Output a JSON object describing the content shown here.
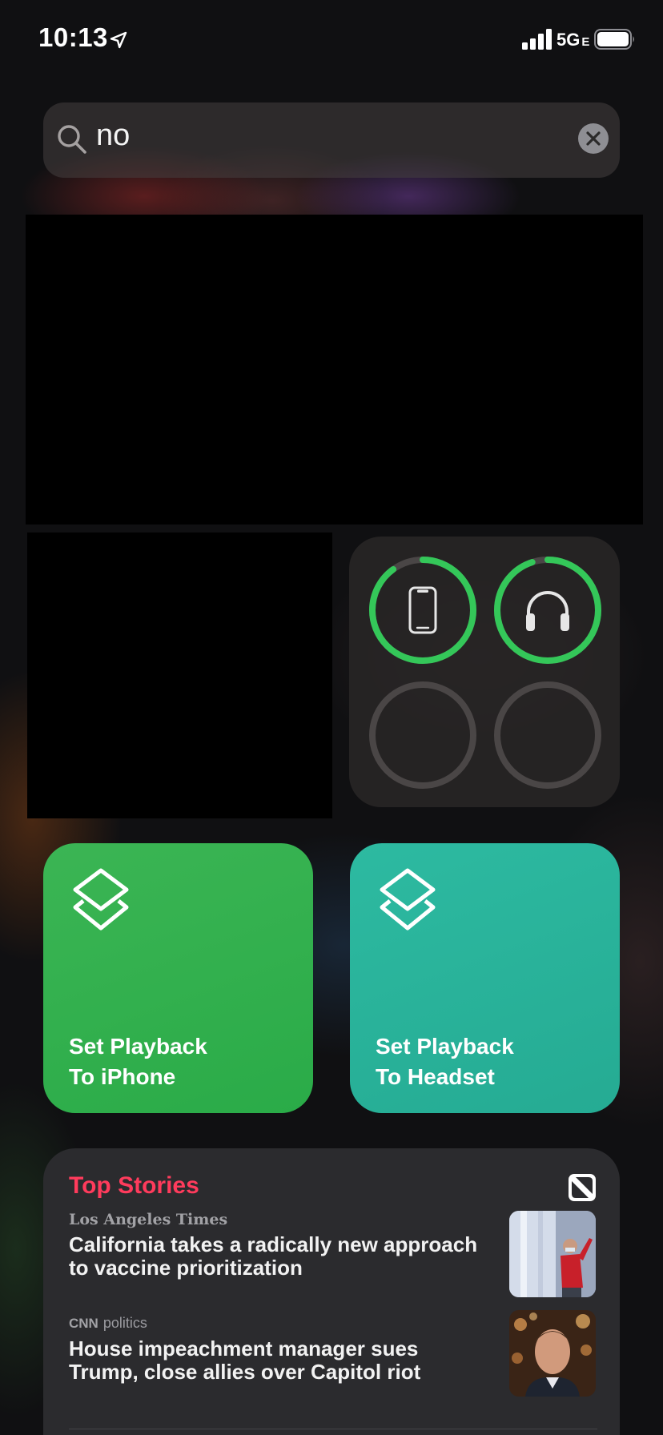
{
  "status_bar": {
    "time": "10:13",
    "network": "5G",
    "network_sub": "E",
    "location_icon": "location-arrow-icon",
    "signal_icon": "cellular-signal-icon",
    "battery_icon": "battery-icon"
  },
  "search": {
    "query": "no",
    "search_icon": "magnifying-glass-icon",
    "clear_icon": "clear-x-icon"
  },
  "batteries_widget": {
    "accent_color": "#34c759",
    "track_color": "#4a4646",
    "devices": [
      {
        "icon": "iphone-icon",
        "level": 0.9
      },
      {
        "icon": "headphones-icon",
        "level": 0.95
      },
      {
        "icon": "empty-slot",
        "level": 0
      },
      {
        "icon": "empty-slot",
        "level": 0
      }
    ]
  },
  "shortcuts": [
    {
      "label_line1": "Set Playback",
      "label_line2": "To iPhone",
      "icon": "shortcuts-layers-icon",
      "color": "#31b04f"
    },
    {
      "label_line1": "Set Playback",
      "label_line2": "To Headset",
      "icon": "shortcuts-layers-icon",
      "color": "#29b39a"
    }
  ],
  "news": {
    "title": "Top Stories",
    "title_color": "#ff3b5c",
    "logo_icon": "apple-news-icon",
    "stories": [
      {
        "source": "Los Angeles Times",
        "section": "",
        "headline": "California takes a radically new approach to vaccine prioritization"
      },
      {
        "source": "CNN",
        "section": "politics",
        "headline": "House impeachment manager sues Trump, close allies over Capitol riot"
      }
    ]
  }
}
